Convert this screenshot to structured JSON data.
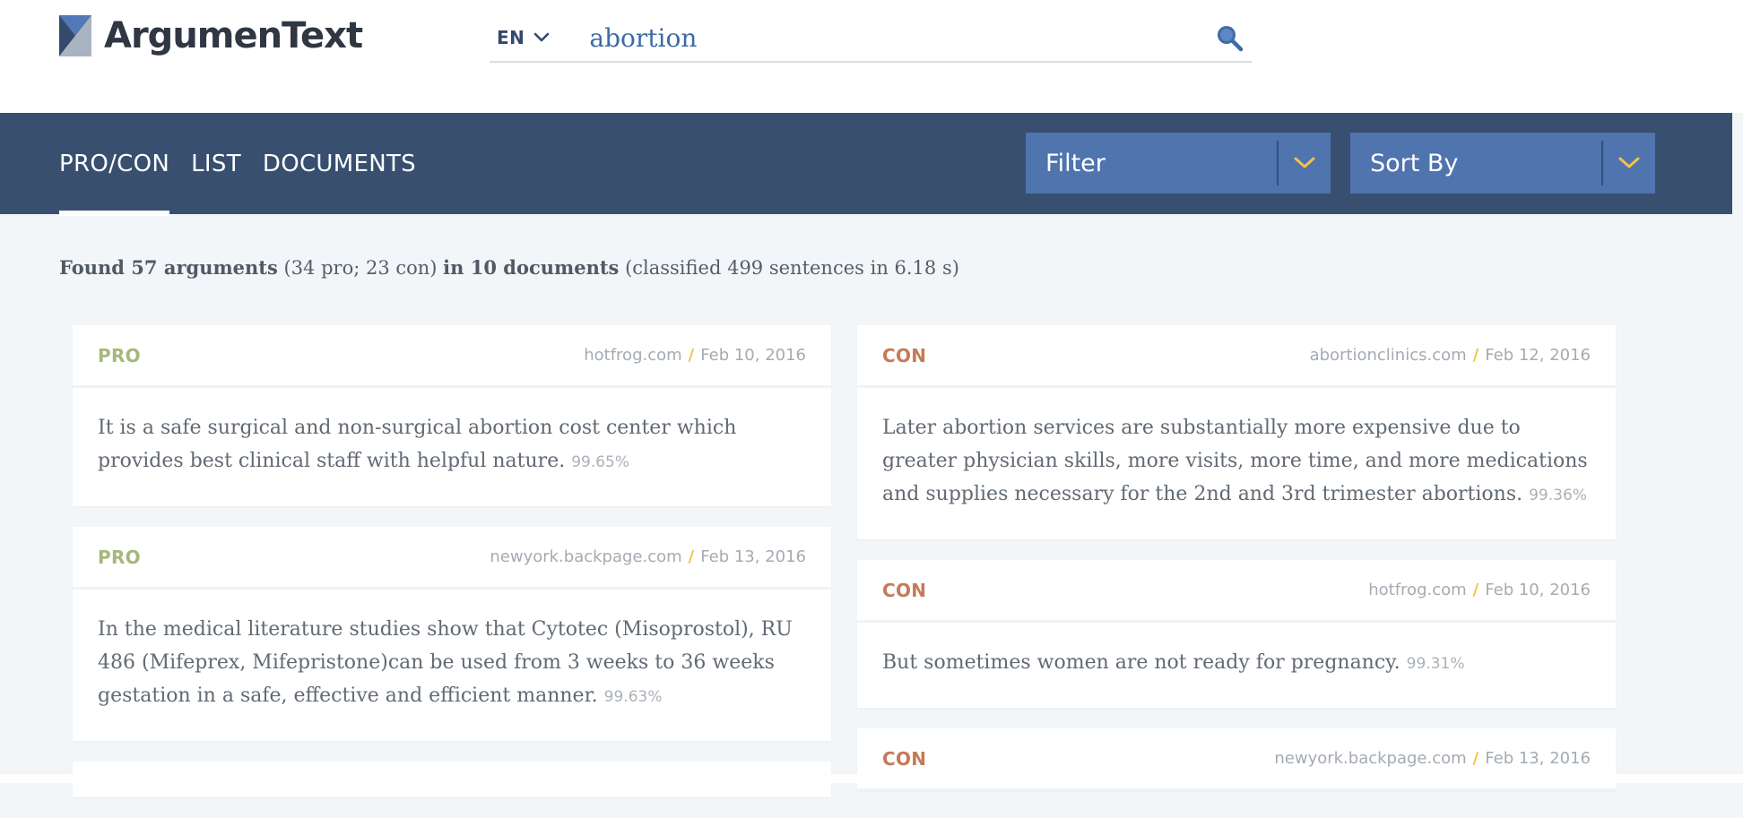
{
  "header": {
    "brand": "ArgumenText",
    "language": "EN",
    "search_value": "abortion",
    "search_icon": "search-icon",
    "brand_colors": {
      "dark": "#344a6c",
      "light": "#a9b3c2",
      "mid": "#5079b6"
    }
  },
  "nav": {
    "tabs": [
      {
        "label": "PRO/CON",
        "active": true
      },
      {
        "label": "LIST",
        "active": false
      },
      {
        "label": "DOCUMENTS",
        "active": false
      }
    ],
    "filter_label": "Filter",
    "sort_label": "Sort By",
    "accent_color": "#f2c14b"
  },
  "summary": {
    "found": "Found 57 arguments",
    "split": " (34 pro; 23 con) ",
    "docs": "in 10 documents",
    "classified": " (classified 499 sentences in 6.18 s)"
  },
  "cards": {
    "left": [
      {
        "stance": "PRO",
        "source": "hotfrog.com",
        "date": "Feb 10, 2016",
        "text": "It is a safe surgical and non-surgical abortion cost center which provides best clinical staff with helpful nature.",
        "score": "99.65%"
      },
      {
        "stance": "PRO",
        "source": "newyork.backpage.com",
        "date": "Feb 13, 2016",
        "text": "In the medical literature studies show that Cytotec (Misoprostol), RU 486 (Mifeprex, Mifepristone)can be used from 3 weeks to 36 weeks gestation in a safe, effective and efficient manner.",
        "score": "99.63%"
      }
    ],
    "right": [
      {
        "stance": "CON",
        "source": "abortionclinics.com",
        "date": "Feb 12, 2016",
        "text": "Later abortion services are substantially more expensive due to greater physician skills, more visits, more time, and more medications and supplies necessary for the 2nd and 3rd trimester abortions.",
        "score": "99.36%"
      },
      {
        "stance": "CON",
        "source": "hotfrog.com",
        "date": "Feb 10, 2016",
        "text": "But sometimes women are not ready for pregnancy.",
        "score": "99.31%"
      },
      {
        "stance": "CON",
        "source": "newyork.backpage.com",
        "date": "Feb 13, 2016",
        "text": "",
        "score": ""
      }
    ]
  }
}
